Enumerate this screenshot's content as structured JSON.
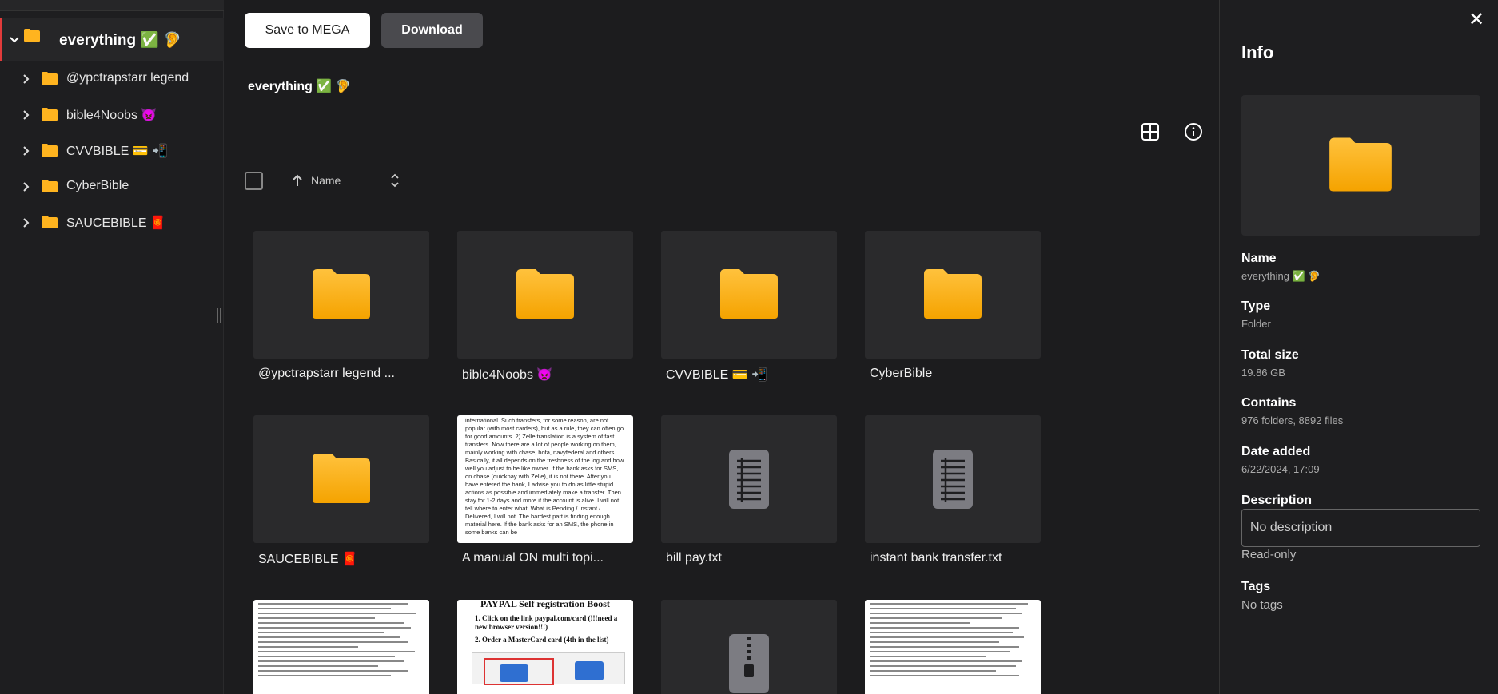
{
  "sidebar": {
    "root_label": "everything ✅ 🦻",
    "items": [
      {
        "label": "@ypctrapstarr legend"
      },
      {
        "label": "bible4Noobs 👿"
      },
      {
        "label": "CVVBIBLE 💳 📲"
      },
      {
        "label": "CyberBible"
      },
      {
        "label": "SAUCEBIBLE 🧧"
      }
    ]
  },
  "toolbar": {
    "save_label": "Save to MEGA",
    "download_label": "Download"
  },
  "breadcrumb": "everything ✅ 🦻",
  "sort": {
    "label": "Name"
  },
  "files": [
    {
      "name": "@ypctrapstarr legend ...",
      "kind": "folder"
    },
    {
      "name": "bible4Noobs 👿",
      "kind": "folder"
    },
    {
      "name": "CVVBIBLE 💳 📲",
      "kind": "folder"
    },
    {
      "name": "CyberBible",
      "kind": "folder"
    },
    {
      "name": "SAUCEBIBLE 🧧",
      "kind": "folder"
    },
    {
      "name": "A manual ON multi topi...",
      "kind": "document-preview"
    },
    {
      "name": "bill pay.txt",
      "kind": "txt"
    },
    {
      "name": "instant bank transfer.txt",
      "kind": "txt"
    },
    {
      "name": "",
      "kind": "document-preview"
    },
    {
      "name": "",
      "kind": "document-preview"
    },
    {
      "name": "",
      "kind": "zip"
    },
    {
      "name": "",
      "kind": "document-preview"
    }
  ],
  "preview_texts": {
    "manual": "international. Such transfers, for some reason, are not popular (with most carders), but as a rule, they can often go for good amounts. 2) Zelle translation is a system of fast transfers. Now there are a lot of people working on them, mainly working with chase, bofa, navyfederal and others. Basically, it all depends on the freshness of the log and how well you adjust to be like owner. If the bank asks for SMS, on chase (quickpay with Zelle), it is not there. After you have entered the bank, I advise you to do as little stupid actions as possible and immediately make a transfer. Then stay for 1-2 days and more if the account is alive. I will not tell where to enter what. What is Pending / Instant / Delivered, I will not. The hardest part is finding enough material here. If the bank asks for an SMS, the phone in some banks can be",
    "paypal_title": "PAYPAL Self registration Boost",
    "paypal_step1": "1. Click on the link paypal.com/card (!!!need a new browser version!!!)",
    "paypal_step2": "2. Order a MasterCard card (4th in the list)"
  },
  "info": {
    "title": "Info",
    "name_label": "Name",
    "name_value": "everything ✅ 🦻",
    "type_label": "Type",
    "type_value": "Folder",
    "size_label": "Total size",
    "size_value": "19.86 GB",
    "contains_label": "Contains",
    "contains_value": "976 folders, 8892 files",
    "date_label": "Date added",
    "date_value": "6/22/2024, 17:09",
    "description_label": "Description",
    "description_placeholder": "No description",
    "readonly_text": "Read-only",
    "tags_label": "Tags",
    "tags_value": "No tags"
  },
  "colors": {
    "folder_top": "#ffc23d",
    "folder_bottom": "#f5a300",
    "accent_red": "#e23b3b",
    "check_green": "#2ec26a"
  }
}
